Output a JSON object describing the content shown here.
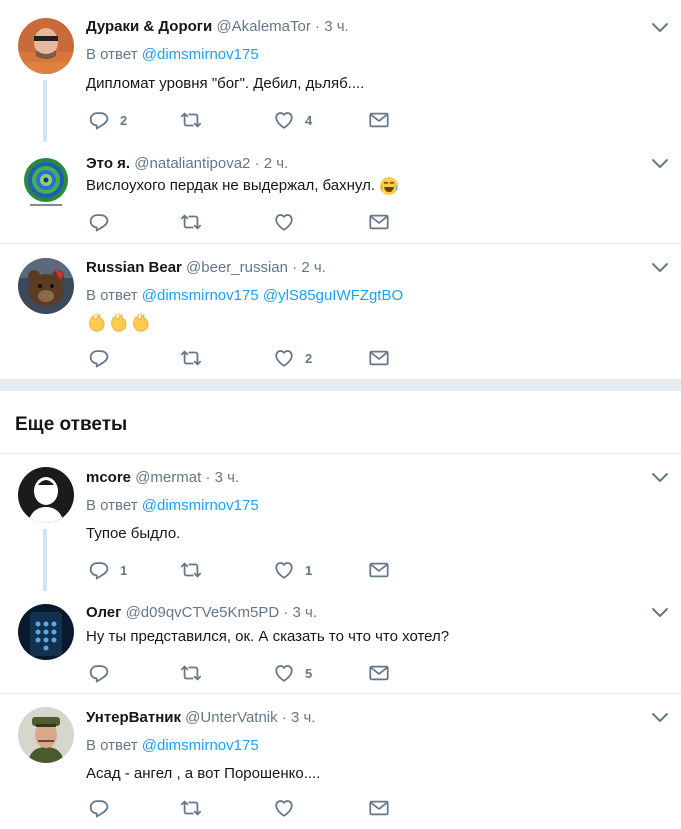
{
  "colors": {
    "accent": "#1da1f2",
    "muted": "#657786",
    "text": "#14171a",
    "divider": "#e6ecf0",
    "thread": "#cce6f7"
  },
  "icons": {
    "reply": "reply-icon",
    "retweet": "retweet-icon",
    "like": "heart-icon",
    "dm": "envelope-icon",
    "more": "chevron-down-icon"
  },
  "tweets": [
    {
      "name": "Дураки & Дороги",
      "handle": "@AkalemaTor",
      "dot": "·",
      "time": "3 ч.",
      "reply_prefix": "В ответ",
      "mention1": "@dimsmirnov175",
      "text": "Дипломат уровня \"бог\". Дебил, дьляб....",
      "replies": "2",
      "likes": "4"
    },
    {
      "name": "Это я.",
      "handle": "@nataliantipova2",
      "dot": "·",
      "time": "2 ч.",
      "text": "Вислоухого пердак не выдержал, бахнул.",
      "emoji": "face-with-tears-of-joy"
    },
    {
      "name": "Russian Bear",
      "handle": "@beer_russian",
      "dot": "·",
      "time": "2 ч.",
      "reply_prefix": "В ответ",
      "mention1": "@dimsmirnov175",
      "mention2": "@ylS85guIWFZgtBO",
      "emoji": "clapping-hands x3",
      "likes": "2"
    }
  ],
  "section": {
    "title": "Еще ответы"
  },
  "more_tweets": [
    {
      "name": "mcore",
      "handle": "@mermat",
      "dot": "·",
      "time": "3 ч.",
      "reply_prefix": "В ответ",
      "mention1": "@dimsmirnov175",
      "text": "Тупое быдло.",
      "replies": "1",
      "likes": "1"
    },
    {
      "name": "Олег",
      "handle": "@d09qvCTVe5Km5PD",
      "dot": "·",
      "time": "3 ч.",
      "text": "Ну ты представился, ок. А сказать то что что хотел?",
      "likes": "5"
    },
    {
      "name": "УнтерВатник",
      "handle": "@UnterVatnik",
      "dot": "·",
      "time": "3 ч.",
      "reply_prefix": "В ответ",
      "mention1": "@dimsmirnov175",
      "text": "Асад - ангел , а вот Порошенко...."
    }
  ]
}
